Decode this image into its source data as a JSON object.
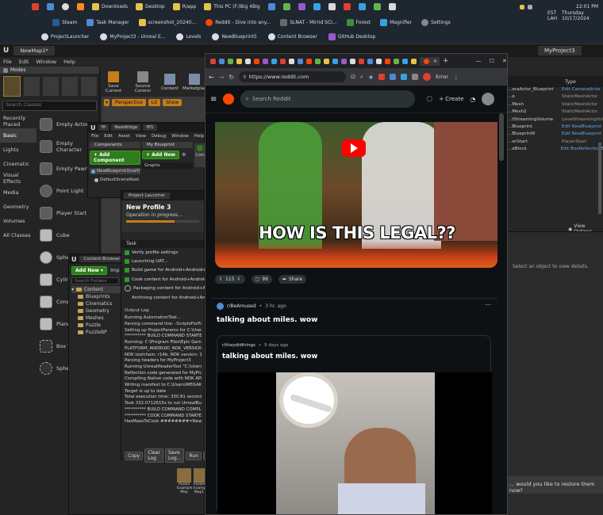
{
  "taskbar": {
    "row1": [
      {
        "label": "Downloads"
      },
      {
        "label": "Desktop"
      },
      {
        "label": "R/app"
      },
      {
        "label": "This PC (F:)Big 4Big"
      }
    ],
    "row2": [
      {
        "label": "Steam"
      },
      {
        "label": "Task Manager"
      },
      {
        "label": "screenshot_20240..."
      },
      {
        "label": "Reddit - Dive into any..."
      },
      {
        "label": "SLNAT - Mirrid SCI..."
      },
      {
        "label": "Forest"
      },
      {
        "label": "Magnifier"
      },
      {
        "label": "Settings"
      }
    ],
    "row3": [
      {
        "label": "ProjectLauncher"
      },
      {
        "label": "MyProject3 - Unreal E..."
      },
      {
        "label": "Levels"
      },
      {
        "label": "NewBlueprint5"
      },
      {
        "label": "Content Browser"
      },
      {
        "label": "GitHub Desktop"
      }
    ],
    "clock": {
      "time": "22:01 PM",
      "tz1": "EST",
      "tz2": "LAH",
      "day": "Thursday",
      "date": "10/17/2024"
    }
  },
  "ue_main": {
    "tab": "NewMap1*",
    "menu": [
      "File",
      "Edit",
      "Window",
      "Help"
    ],
    "window_title": "MyProject3",
    "modes_tab": "Modes",
    "search_placeholder": "Search Classes",
    "categories": [
      "Recently Placed",
      "Basic",
      "Lights",
      "Cinematic",
      "Visual Effects",
      "Media",
      "Geometry",
      "Volumes",
      "All Classes"
    ],
    "active_category": "Basic",
    "place_items": [
      "Empty Actor",
      "Empty Character",
      "Empty Pawn",
      "Point Light",
      "Player Start",
      "Cube",
      "Sphere",
      "Cylinder",
      "Cone",
      "Plane",
      "Box Trigger",
      "Sphere Trigger"
    ],
    "toolbar": [
      "Save Current",
      "Source Control",
      "Content",
      "Marketplace"
    ],
    "viewport_buttons": [
      "Perspective",
      "Lit",
      "Show"
    ],
    "details_text": "Select an object to view details.",
    "restore_text": "... would you like to restore them now?",
    "outliner_header": "Type",
    "outliner_rows": [
      {
        "name": "...eraActor_Blueprint",
        "type": "Edit CameraActor",
        "link": true
      },
      {
        "name": "...e",
        "type": "StaticMeshActor",
        "link": false
      },
      {
        "name": "...Mesh",
        "type": "StaticMeshActor",
        "link": false
      },
      {
        "name": "...Mesh2",
        "type": "StaticMeshActor",
        "link": false
      },
      {
        "name": "...tStreamingVolume",
        "type": "LevelStreamingVol",
        "link": false
      },
      {
        "name": "...Blueprint",
        "type": "Edit NewBlueprint",
        "link": true
      },
      {
        "name": "...Blueprint6",
        "type": "Edit NewBlueprint",
        "link": true
      },
      {
        "name": "...erStart",
        "type": "PlayerStart",
        "link": false
      },
      {
        "name": "...eBlock",
        "type": "Edit BoxReflectionB",
        "link": true
      }
    ],
    "view_options": "View Options"
  },
  "blueprint_editor": {
    "tabs": [
      "fff",
      "NewWidge",
      "fff1"
    ],
    "menu": [
      "File",
      "Edit",
      "Asset",
      "View",
      "Debug",
      "Window",
      "Help"
    ],
    "components_tab": "Components",
    "my_blueprint_tab": "My Blueprint",
    "add_component": "+ Add Component",
    "add_new": "+ Add New",
    "self_item": "NewBlueprint3(self)",
    "default_scene": "DefaultSceneRoot",
    "graphs": "Graphs",
    "compile": "Com"
  },
  "content_browser": {
    "tab": "Content Browser",
    "add_new": "Add New",
    "import": "Imp",
    "search_placeholder": "Search Folders",
    "tree": [
      "Content",
      "Blueprints",
      "Cinematics",
      "Geometry",
      "Meshes",
      "Puzzle",
      "PuzzleBP"
    ],
    "assets": [
      "Puzzle Example Map",
      "Puzzle Example Map1"
    ]
  },
  "project_launcher": {
    "tab": "Project Launcher",
    "title": "New Profile 3",
    "status": "Operation in progress...",
    "task_header": "Task",
    "tasks": [
      {
        "label": "Verify profile settings",
        "done": true
      },
      {
        "label": "Launching UAT...",
        "done": true
      },
      {
        "label": "Build game for Android+Android+Android",
        "done": true
      },
      {
        "label": "Cook content for Android+Android+Android",
        "done": true
      },
      {
        "label": "Packaging content for Android+Android+Android",
        "done": false
      },
      {
        "label": "Archiving content for Android+Android+Android",
        "done": false
      }
    ],
    "output_header": "Output Log",
    "log": [
      "Running AutomationTool...",
      "Parsing command line: -ScriptsForProject=\"C:/Users/MEGAK/",
      "Setting up ProjectParams for C:\\Users\\MEGAK\\OneDrive",
      "********** BUILD COMMAND STARTED **********",
      "Running: C:\\Program Files\\Epic Games\\UE_4.27\\Eng",
      "  PLATFORM_ANDROID_NDK_VERSION = 140200",
      "  NDK toolchain: r14b, NDK version: 19, GccVersion",
      "  Parsing headers for MyProject3",
      "    Running UnrealHeaderTool \"C:\\Users\\MEGAK\\OneD",
      "  Reflection code generated for MyProject3 in 2.4",
      "  Compiling Native code with NDK API 'android-19'",
      "  Writing manifest to C:\\Users\\MEGAK\\OneDrive",
      "  Target is up to date",
      "  Total execution time: 330.81 seconds",
      "Took 332.0712615s to run UnrealBuildTool.exe, Ex",
      "********** BUILD COMMAND COMPLETED **********",
      "********** COOK COMMAND STARTED **********",
      "HasMaosToCook ########=NewWorld+PuzzleExample"
    ],
    "buttons": [
      "Copy",
      "Clear Log",
      "Save Log...",
      "Run",
      "Cl"
    ]
  },
  "browser": {
    "error_label": "Error",
    "url": "https://www.reddit.com",
    "search_placeholder": "Search Reddit",
    "create": "Create",
    "post1": {
      "video_caption": "HOW IS THIS LEGAL??",
      "upvotes": "115",
      "comments": "99",
      "share": "Share"
    },
    "post2": {
      "subreddit": "r/BeAmused",
      "age": "3 hr. ago",
      "title": "talking about miles. wow",
      "crosspost_subreddit": "r/theydidthings",
      "crosspost_age": "5 days ago",
      "crosspost_title": "talking about miles. wow"
    }
  },
  "colors": {
    "reddit_orange": "#ff4500",
    "ue_green": "#2f7d1c",
    "ue_orange": "#c57d1a",
    "link_blue": "#5fa8e8"
  }
}
